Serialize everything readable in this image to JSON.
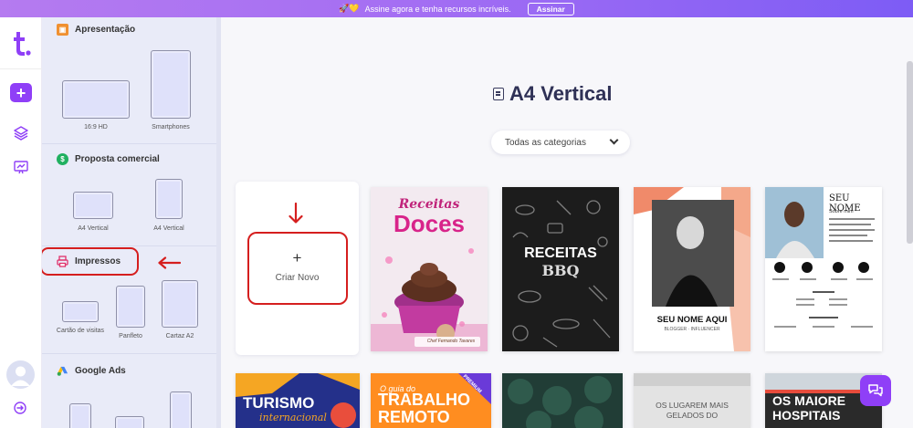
{
  "colors": {
    "brand_purple": "#8f3ff7",
    "banner_start": "#b57bf0",
    "banner_end": "#7d5cf5",
    "panel_bg": "#e9ebf8",
    "highlight_red": "#d51e1e",
    "heading": "#2f3156"
  },
  "banner": {
    "emoji": "🚀💛",
    "text": "Assine agora e tenha recursos incríveis.",
    "cta": "Assinar"
  },
  "rail": {
    "logo": "t.",
    "add_icon": "plus-icon",
    "icons": [
      "layers-icon",
      "presentation-check-icon"
    ],
    "bottom_icons": [
      "user-avatar",
      "logout-icon"
    ]
  },
  "sidebar": {
    "sections": [
      {
        "title": "Apresentação",
        "icon": "presentation-icon",
        "items": [
          "16:9 HD",
          "Smartphones"
        ]
      },
      {
        "title": "Proposta comercial",
        "icon": "dollar-icon",
        "items": [
          "A4 Vertical",
          "A4 Vertical"
        ]
      },
      {
        "title": "Impressos",
        "icon": "printer-icon",
        "items": [
          "Cartão de visitas",
          "Panfleto",
          "Cartaz A2"
        ]
      },
      {
        "title": "Google Ads",
        "icon": "google-ads-icon",
        "items": []
      }
    ]
  },
  "main": {
    "title": "A4 Vertical",
    "category_select": "Todas as categorias",
    "create_button": {
      "plus": "+",
      "label": "Criar Novo"
    },
    "templates": [
      {
        "title_line1": "Receitas",
        "title_line2": "Doces",
        "footer": "Chef Fernando Tavares"
      },
      {
        "title_line1": "RECEITAS",
        "title_line2": "BBQ"
      },
      {
        "title": "SEU NOME AQUI",
        "subtitle": "BLOGGER · INFLUENCER"
      },
      {
        "title_line1": "SEU",
        "title_line2": "NOME",
        "subtitle": "Sobre mim"
      }
    ],
    "templates_row2": [
      {
        "title": "TURISMO",
        "subtitle": "internacional"
      },
      {
        "pretitle": "O guia do",
        "title_line1": "TRABALHO",
        "title_line2": "REMOTO",
        "badge": "PREMIUM"
      },
      {
        "title": ""
      },
      {
        "title_line1": "OS LUGAREM MAIS",
        "title_line2": "GELADOS DO"
      },
      {
        "title_line1": "OS MAIORE",
        "title_line2": "HOSPITAIS"
      }
    ]
  },
  "chat_icon": "chat-bubbles-icon"
}
